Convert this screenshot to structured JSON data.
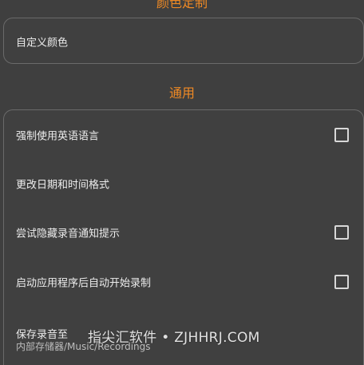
{
  "sections": {
    "color": {
      "title": "颜色定制",
      "custom_color_label": "自定义颜色"
    },
    "general": {
      "title": "通用",
      "items": [
        {
          "label": "强制使用英语语言",
          "checked": false
        },
        {
          "label": "更改日期和时间格式"
        },
        {
          "label": "尝试隐藏录音通知提示",
          "checked": false
        },
        {
          "label": "启动应用程序后自动开始录制",
          "checked": false
        },
        {
          "label": "保存录音至",
          "sublabel": "内部存储器/Music/Recordings"
        }
      ]
    }
  },
  "watermark": "指尖汇软件 • ZJHHRJ.COM",
  "colors": {
    "accent": "#f08a24",
    "background": "#3f3f3f",
    "card_border": "#6a6a6a",
    "text": "#ededed"
  }
}
